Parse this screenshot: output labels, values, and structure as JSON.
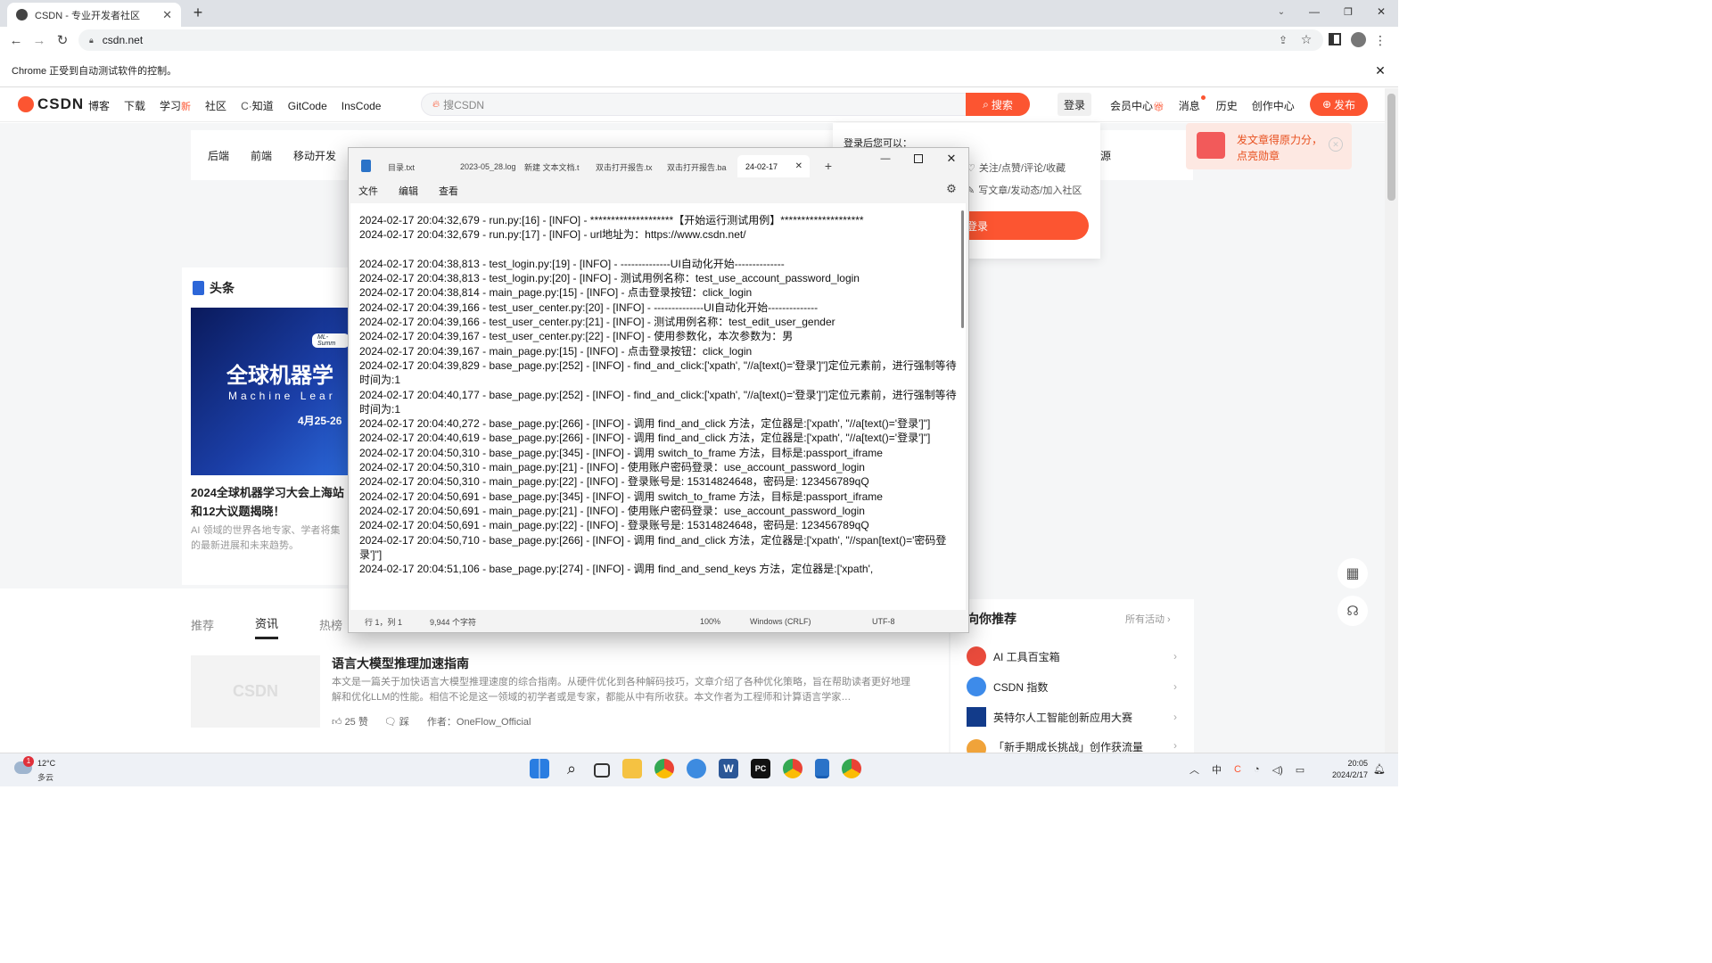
{
  "browser": {
    "tab_title": "CSDN - 专业开发者社区",
    "url": "csdn.net",
    "automation_notice": "Chrome 正受到自动测试软件的控制。"
  },
  "csdn": {
    "logo": "CSDN",
    "nav": [
      "博客",
      "下载",
      "学习",
      "社区",
      "知道",
      "GitCode",
      "InsCode"
    ],
    "nav_new_badge": "新",
    "search_placeholder": "搜CSDN",
    "search_button": "搜索",
    "header_right": [
      "登录",
      "会员中心",
      "消息",
      "历史",
      "创作中心"
    ],
    "publish_button": "发布",
    "categories": [
      "后端",
      "前端",
      "移动开发"
    ],
    "login_popup": {
      "title": "登录后您可以：",
      "items": [
        "关注/点赞/评论/收藏",
        "写文章/发动态/加入社区"
      ],
      "button": "登录"
    },
    "banner_text": [
      "发文章得原力分，",
      "点亮勋章"
    ],
    "cat_partial": "源",
    "headline_section": "头条",
    "headline_image_text": [
      "全球机器学",
      "Machine Lear",
      "4月25-26",
      "ML-Summ"
    ],
    "headline_title": [
      "2024全球机器学习大会上海站",
      "和12大议题揭晓！"
    ],
    "headline_desc": [
      "AI 领域的世界各地专家、学者将集",
      "的最新进展和未来趋势。"
    ],
    "feed_tabs": [
      "推荐",
      "资讯",
      "热榜"
    ],
    "article": {
      "title": "语言大模型推理加速指南",
      "desc": "本文是一篇关于加快语言大模型推理速度的综合指南。从硬件优化到各种解码技巧，文章介绍了各种优化策略，旨在帮助读者更好地理解和优化LLM的性能。相信不论是这一领域的初学者或是专家，都能从中有所收获。本文作者为工程师和计算语言学家…",
      "likes": "25 赞",
      "dislike": "踩",
      "author": "作者：OneFlow_Official",
      "thumb_logo": "CSDN"
    },
    "recommend": {
      "title": "向你推荐",
      "more": "所有活动",
      "items": [
        "AI 工具百宝箱",
        "CSDN 指数",
        "英特尔人工智能创新应用大赛",
        "「新手期成长挑战」创作获流量"
      ]
    }
  },
  "notepad": {
    "tabs": [
      "目录.txt",
      "2023-05_28.log",
      "新建 文本文档.t",
      "双击打开报告.tx",
      "双击打开报告.ba",
      "24-02-17"
    ],
    "menu": [
      "文件",
      "编辑",
      "查看"
    ],
    "status": {
      "position": "行 1，列 1",
      "chars": "9,944 个字符",
      "zoom": "100%",
      "eol": "Windows (CRLF)",
      "encoding": "UTF-8"
    },
    "content": "2024-02-17 20:04:32,679 - run.py:[16] - [INFO] - ********************【开始运行测试用例】********************\n2024-02-17 20:04:32,679 - run.py:[17] - [INFO] - url地址为：https://www.csdn.net/\n\n2024-02-17 20:04:38,813 - test_login.py:[19] - [INFO] - --------------UI自动化开始--------------\n2024-02-17 20:04:38,813 - test_login.py:[20] - [INFO] - 测试用例名称：test_use_account_password_login\n2024-02-17 20:04:38,814 - main_page.py:[15] - [INFO] - 点击登录按钮：click_login\n2024-02-17 20:04:39,166 - test_user_center.py:[20] - [INFO] - --------------UI自动化开始--------------\n2024-02-17 20:04:39,166 - test_user_center.py:[21] - [INFO] - 测试用例名称：test_edit_user_gender\n2024-02-17 20:04:39,167 - test_user_center.py:[22] - [INFO] - 使用参数化，本次参数为：男\n2024-02-17 20:04:39,167 - main_page.py:[15] - [INFO] - 点击登录按钮：click_login\n2024-02-17 20:04:39,829 - base_page.py:[252] - [INFO] - find_and_click:['xpath', \"//a[text()='登录']\"]定位元素前，进行强制等待时间为:1\n2024-02-17 20:04:40,177 - base_page.py:[252] - [INFO] - find_and_click:['xpath', \"//a[text()='登录']\"]定位元素前，进行强制等待时间为:1\n2024-02-17 20:04:40,272 - base_page.py:[266] - [INFO] - 调用 find_and_click 方法，定位器是:['xpath', \"//a[text()='登录']\"]\n2024-02-17 20:04:40,619 - base_page.py:[266] - [INFO] - 调用 find_and_click 方法，定位器是:['xpath', \"//a[text()='登录']\"]\n2024-02-17 20:04:50,310 - base_page.py:[345] - [INFO] - 调用 switch_to_frame 方法，目标是:passport_iframe\n2024-02-17 20:04:50,310 - main_page.py:[21] - [INFO] - 使用账户密码登录：use_account_password_login\n2024-02-17 20:04:50,310 - main_page.py:[22] - [INFO] - 登录账号是: 15314824648，密码是: 123456789qQ\n2024-02-17 20:04:50,691 - base_page.py:[345] - [INFO] - 调用 switch_to_frame 方法，目标是:passport_iframe\n2024-02-17 20:04:50,691 - main_page.py:[21] - [INFO] - 使用账户密码登录：use_account_password_login\n2024-02-17 20:04:50,691 - main_page.py:[22] - [INFO] - 登录账号是: 15314824648，密码是: 123456789qQ\n2024-02-17 20:04:50,710 - base_page.py:[266] - [INFO] - 调用 find_and_click 方法，定位器是:['xpath', \"//span[text()='密码登录']\"]\n2024-02-17 20:04:51,106 - base_page.py:[274] - [INFO] - 调用 find_and_send_keys 方法，定位器是:['xpath',"
  },
  "taskbar": {
    "temp": "12°C",
    "weather": "多云",
    "weather_badge": "1",
    "time": "20:05",
    "date": "2024/2/17"
  },
  "colors": {
    "accent": "#fc5531",
    "tabbar": "#dee1e6",
    "page_bg": "#f5f6f7"
  }
}
